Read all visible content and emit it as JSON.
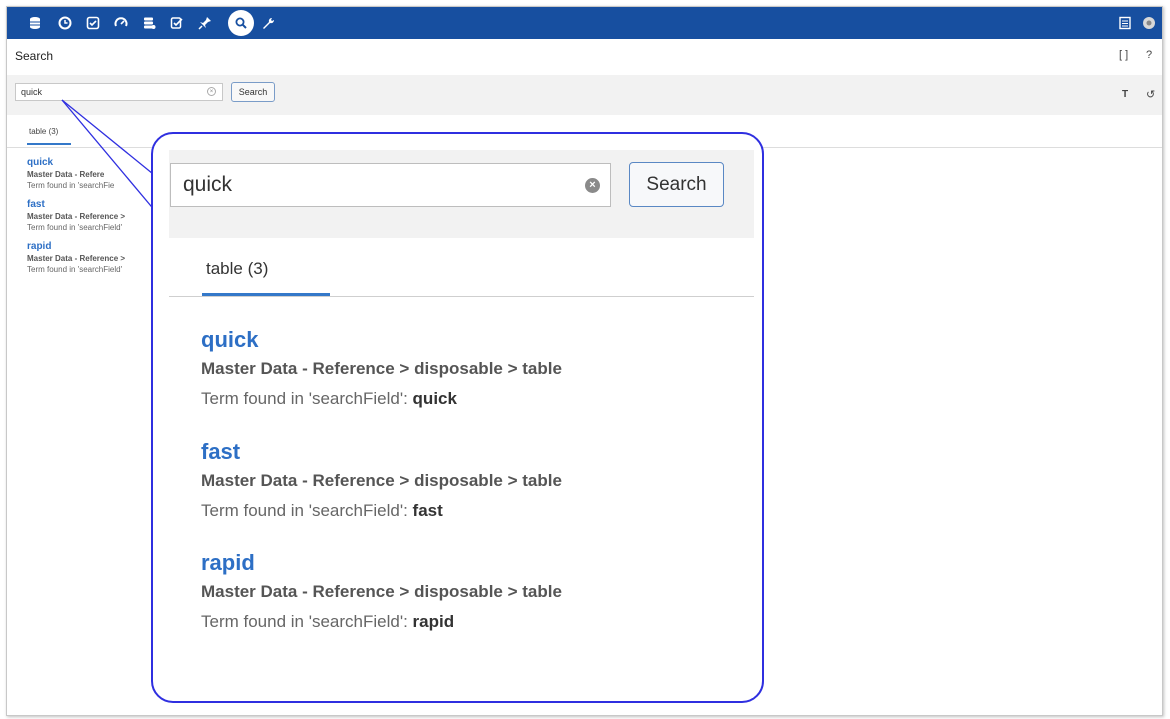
{
  "topbar": {
    "icons": [
      "database-icon",
      "clock-icon",
      "task-check-icon",
      "gauge-icon",
      "stack-icon",
      "edit-check-icon",
      "pin-icon",
      "search-icon",
      "wrench-icon"
    ],
    "active_icon": "search-icon",
    "right_icons": [
      "grid-icon",
      "user-avatar-icon"
    ],
    "bar_color": "#174fa0"
  },
  "page": {
    "title": "Search"
  },
  "search": {
    "value": "quick",
    "button_label": "Search"
  },
  "tab": {
    "label": "table (3)",
    "label_small": "table (3)"
  },
  "results": [
    {
      "title": "quick",
      "path": "Master Data - Reference > disposable > table",
      "term_prefix": "Term found in 'searchField':",
      "term": "quick"
    },
    {
      "title": "fast",
      "path": "Master Data - Reference > disposable > table",
      "term_prefix": "Term found in 'searchField':",
      "term": "fast"
    },
    {
      "title": "rapid",
      "path": "Master Data - Reference > disposable > table",
      "term_prefix": "Term found in 'searchField':",
      "term": "rapid"
    }
  ],
  "small_results": [
    {
      "title": "quick",
      "path": "Master Data - Refere",
      "term": "Term found in 'searchFie"
    },
    {
      "title": "fast",
      "path": "Master Data - Reference >",
      "term": "Term found in 'searchField'"
    },
    {
      "title": "rapid",
      "path": "Master Data - Reference >",
      "term": "Term found in 'searchField'"
    }
  ],
  "title_icons": {
    "expand": "[ ]",
    "help": "?"
  },
  "toolbar_icons": {
    "filter": "T",
    "reset": "↺"
  },
  "accent": "#2d6fc5",
  "callout_color": "#2f2fe0"
}
